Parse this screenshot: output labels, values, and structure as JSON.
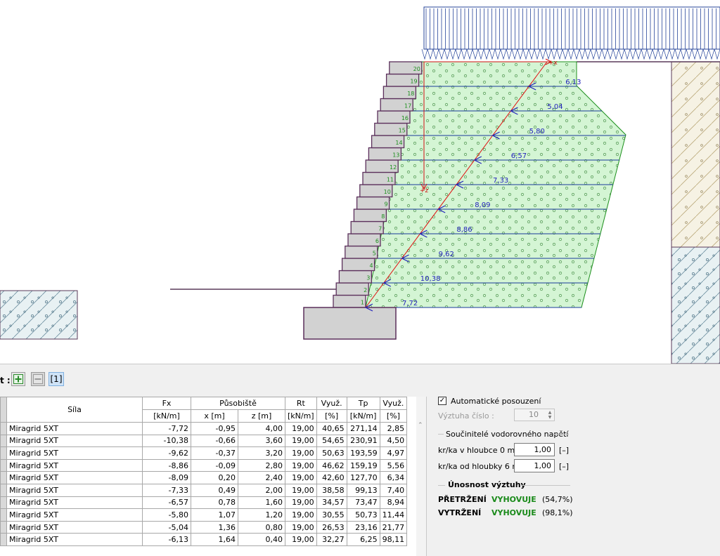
{
  "drawing": {
    "layer_labels": [
      "1",
      "2",
      "3",
      "4",
      "5",
      "6",
      "7",
      "8",
      "9",
      "10",
      "11",
      "12",
      "13",
      "14",
      "15",
      "16",
      "17",
      "18",
      "19",
      "20"
    ],
    "force_labels": [
      "7,72",
      "10,38",
      "9,62",
      "8,86",
      "8,09",
      "7,33",
      "6,57",
      "5,80",
      "5,04",
      "6,13"
    ],
    "axis_x_label": "+x",
    "axis_z_label": "+z"
  },
  "toolbar": {
    "label": "t :",
    "add_icon": "plus-icon",
    "remove_icon": "minus-icon",
    "item_label": "[1]"
  },
  "table": {
    "header": {
      "sila": "Síla",
      "fx": "Fx",
      "fx_unit": "[kN/m]",
      "pusobiste": "Působiště",
      "x_unit": "x [m]",
      "z_unit": "z [m]",
      "rt": "Rt",
      "rt_unit": "[kN/m]",
      "vyuz1": "Využ.",
      "vyuz1_unit": "[%]",
      "tp": "Tp",
      "tp_unit": "[kN/m]",
      "vyuz2": "Využ.",
      "vyuz2_unit": "[%]"
    },
    "rows": [
      {
        "name": "Miragrid 5XT",
        "fx": "-7,72",
        "x": "-0,95",
        "z": "4,00",
        "rt": "19,00",
        "v1": "40,65",
        "tp": "271,14",
        "v2": "2,85"
      },
      {
        "name": "Miragrid 5XT",
        "fx": "-10,38",
        "x": "-0,66",
        "z": "3,60",
        "rt": "19,00",
        "v1": "54,65",
        "tp": "230,91",
        "v2": "4,50"
      },
      {
        "name": "Miragrid 5XT",
        "fx": "-9,62",
        "x": "-0,37",
        "z": "3,20",
        "rt": "19,00",
        "v1": "50,63",
        "tp": "193,59",
        "v2": "4,97"
      },
      {
        "name": "Miragrid 5XT",
        "fx": "-8,86",
        "x": "-0,09",
        "z": "2,80",
        "rt": "19,00",
        "v1": "46,62",
        "tp": "159,19",
        "v2": "5,56"
      },
      {
        "name": "Miragrid 5XT",
        "fx": "-8,09",
        "x": "0,20",
        "z": "2,40",
        "rt": "19,00",
        "v1": "42,60",
        "tp": "127,70",
        "v2": "6,34"
      },
      {
        "name": "Miragrid 5XT",
        "fx": "-7,33",
        "x": "0,49",
        "z": "2,00",
        "rt": "19,00",
        "v1": "38,58",
        "tp": "99,13",
        "v2": "7,40"
      },
      {
        "name": "Miragrid 5XT",
        "fx": "-6,57",
        "x": "0,78",
        "z": "1,60",
        "rt": "19,00",
        "v1": "34,57",
        "tp": "73,47",
        "v2": "8,94"
      },
      {
        "name": "Miragrid 5XT",
        "fx": "-5,80",
        "x": "1,07",
        "z": "1,20",
        "rt": "19,00",
        "v1": "30,55",
        "tp": "50,73",
        "v2": "11,44"
      },
      {
        "name": "Miragrid 5XT",
        "fx": "-5,04",
        "x": "1,36",
        "z": "0,80",
        "rt": "19,00",
        "v1": "26,53",
        "tp": "23,16",
        "v2": "21,77"
      },
      {
        "name": "Miragrid 5XT",
        "fx": "-6,13",
        "x": "1,64",
        "z": "0,40",
        "rt": "19,00",
        "v1": "32,27",
        "tp": "6,25",
        "v2": "98,11"
      }
    ]
  },
  "panel": {
    "auto_check_label": "Automatické posouzení",
    "auto_check_checked": true,
    "vyztuha_label": "Výztuha číslo :",
    "vyztuha_value": "10",
    "group1_title": "Součinitelé vodorovného napětí",
    "k_top_label": "kr/ka v hloubce 0 m :",
    "k_top_value": "1,00",
    "k_bottom_label": "kr/ka od hloubky 6 m :",
    "k_bottom_value": "1,00",
    "unit": "[–]",
    "group2_title": "Únosnost výztuhy",
    "r1_label": "PŘETRŽENÍ",
    "r1_status": "VYHOVUJE",
    "r1_pct": "(54,7%)",
    "r2_label": "VYTRŽENÍ",
    "r2_status": "VYHOVUJE",
    "r2_pct": "(98,1%)"
  },
  "colors": {
    "reinforced_fill": "#d4f5d4",
    "reinforced_stroke": "#1b8f1b",
    "wall_fill": "#d2d2d2",
    "wall_stroke": "#5b2f5b",
    "force_color": "#2222bb",
    "axis_color": "#d01010",
    "surcharge_color": "#27459a",
    "ok_color": "#1a8a1a"
  }
}
